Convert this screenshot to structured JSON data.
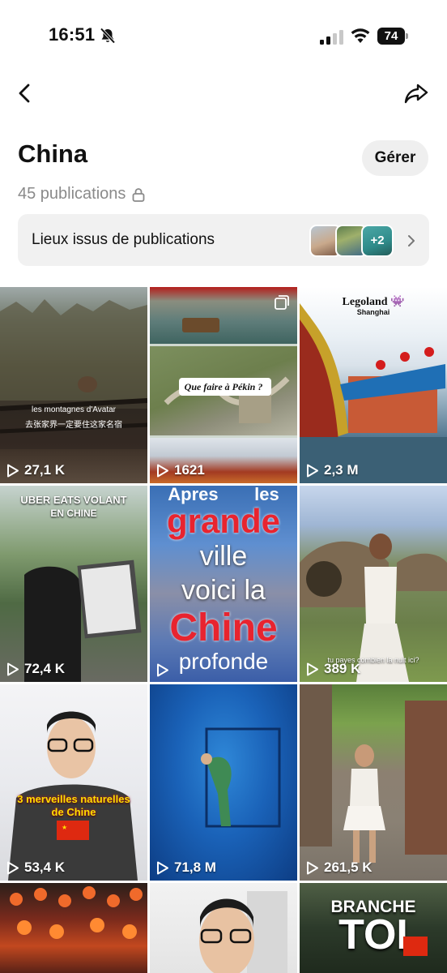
{
  "status": {
    "time": "16:51",
    "battery": "74"
  },
  "header": {
    "title": "China",
    "manage_label": "Gérer",
    "count_label": "45 publications"
  },
  "places": {
    "label": "Lieux issus de publications",
    "more": "+2"
  },
  "grid": [
    {
      "views": "27,1 K",
      "caption": "les montagnes d'Avatar",
      "caption2": "去张家界一定要住这家名宿"
    },
    {
      "views": "1621",
      "caption": "Que faire à Pékin ?"
    },
    {
      "views": "2,3 M",
      "caption": "Legoland 👾",
      "caption2": "Shanghai"
    },
    {
      "views": "72,4 K",
      "caption": "UBER EATS VOLANT",
      "caption2": "EN CHINE"
    },
    {
      "views": "",
      "lines": [
        "Apres",
        "les",
        "grande",
        "ville",
        "voici la",
        "Chine",
        "profonde"
      ]
    },
    {
      "views": "389 K",
      "caption": "tu payes combien la nuit ici?"
    },
    {
      "views": "53,4 K",
      "caption": "3 merveilles naturelles",
      "caption2": "de Chine"
    },
    {
      "views": "71,8 M"
    },
    {
      "views": "261,5 K"
    },
    {
      "views": ""
    },
    {
      "views": ""
    },
    {
      "views": "",
      "caption": "BRANCHE",
      "caption2": "TOI"
    }
  ]
}
